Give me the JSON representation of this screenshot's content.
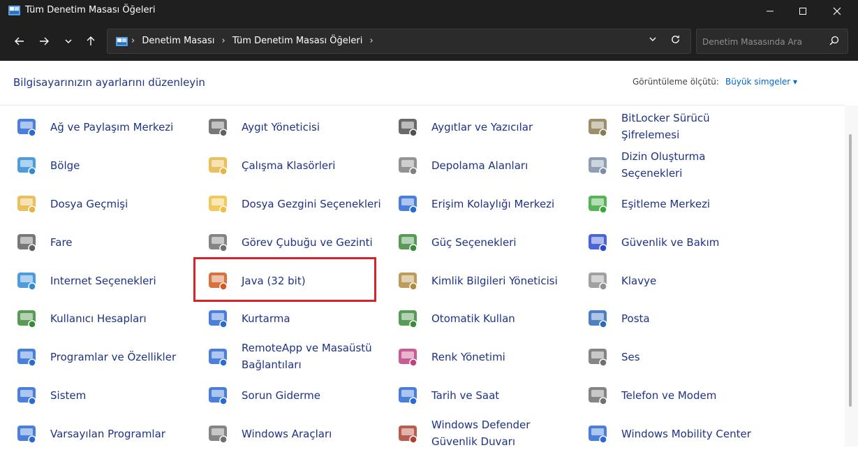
{
  "window": {
    "title": "Tüm Denetim Masası Öğeleri",
    "minimize_icon": "minimize-icon",
    "maximize_icon": "maximize-icon",
    "close_icon": "close-icon"
  },
  "address": {
    "breadcrumbs": [
      "Denetim Masası",
      "Tüm Denetim Masası Öğeleri"
    ],
    "separator": "›"
  },
  "search": {
    "placeholder": "Denetim Masasında Ara"
  },
  "page": {
    "heading": "Bilgisayarınızın ayarlarını düzenleyin",
    "view_by_label": "Görüntüleme ölçütü:",
    "view_by_value": "Büyük simgeler ▾"
  },
  "items": [
    {
      "l1": "Ağ ve Paylaşım Merkezi",
      "l2": "",
      "icon": "network-icon",
      "color": "#2a6ad6"
    },
    {
      "l1": "Aygıt Yöneticisi",
      "l2": "",
      "icon": "device-manager-icon",
      "color": "#606060"
    },
    {
      "l1": "Aygıtlar ve Yazıcılar",
      "l2": "",
      "icon": "printer-icon",
      "color": "#505050"
    },
    {
      "l1": "BitLocker Sürücü",
      "l2": "Şifrelemesi",
      "icon": "bitlocker-icon",
      "color": "#8a7a50"
    },
    {
      "l1": "Bölge",
      "l2": "",
      "icon": "globe-clock-icon",
      "color": "#2e8bd8"
    },
    {
      "l1": "Çalışma Klasörleri",
      "l2": "",
      "icon": "work-folders-icon",
      "color": "#e8b440"
    },
    {
      "l1": "Depolama Alanları",
      "l2": "",
      "icon": "storage-icon",
      "color": "#808080"
    },
    {
      "l1": "Dizin Oluşturma",
      "l2": "Seçenekleri",
      "icon": "indexing-icon",
      "color": "#7a8ea8"
    },
    {
      "l1": "Dosya Geçmişi",
      "l2": "",
      "icon": "file-history-icon",
      "color": "#e8b440"
    },
    {
      "l1": "Dosya Gezgini Seçenekleri",
      "l2": "",
      "icon": "folder-options-icon",
      "color": "#f0c040"
    },
    {
      "l1": "Erişim Kolaylığı Merkezi",
      "l2": "",
      "icon": "accessibility-icon",
      "color": "#2a6ad6"
    },
    {
      "l1": "Eşitleme Merkezi",
      "l2": "",
      "icon": "sync-icon",
      "color": "#3aa83a"
    },
    {
      "l1": "Fare",
      "l2": "",
      "icon": "mouse-icon",
      "color": "#606060"
    },
    {
      "l1": "Görev Çubuğu ve Gezinti",
      "l2": "",
      "icon": "taskbar-icon",
      "color": "#707070"
    },
    {
      "l1": "Güç Seçenekleri",
      "l2": "",
      "icon": "power-icon",
      "color": "#3a8a3a"
    },
    {
      "l1": "Güvenlik ve Bakım",
      "l2": "",
      "icon": "security-flag-icon",
      "color": "#2a4ad6"
    },
    {
      "l1": "Internet Seçenekleri",
      "l2": "",
      "icon": "internet-options-icon",
      "color": "#2e8bd8"
    },
    {
      "l1": "Java (32 bit)",
      "l2": "",
      "icon": "java-icon",
      "color": "#d05a20"
    },
    {
      "l1": "Kimlik Bilgileri Yöneticisi",
      "l2": "",
      "icon": "credential-icon",
      "color": "#b08a40"
    },
    {
      "l1": "Klavye",
      "l2": "",
      "icon": "keyboard-icon",
      "color": "#909090"
    },
    {
      "l1": "Kullanıcı Hesapları",
      "l2": "",
      "icon": "user-accounts-icon",
      "color": "#3a8a3a"
    },
    {
      "l1": "Kurtarma",
      "l2": "",
      "icon": "recovery-icon",
      "color": "#2a6ad6"
    },
    {
      "l1": "Otomatik Kullan",
      "l2": "",
      "icon": "autoplay-icon",
      "color": "#3a8a3a"
    },
    {
      "l1": "Posta",
      "l2": "",
      "icon": "mail-icon",
      "color": "#2e6ab8"
    },
    {
      "l1": "Programlar ve Özellikler",
      "l2": "",
      "icon": "programs-icon",
      "color": "#2a6ad6"
    },
    {
      "l1": "RemoteApp ve Masaüstü",
      "l2": "Bağlantıları",
      "icon": "remoteapp-icon",
      "color": "#2a6ad6"
    },
    {
      "l1": "Renk Yönetimi",
      "l2": "",
      "icon": "color-management-icon",
      "color": "#c04080"
    },
    {
      "l1": "Ses",
      "l2": "",
      "icon": "speaker-icon",
      "color": "#707070"
    },
    {
      "l1": "Sistem",
      "l2": "",
      "icon": "system-icon",
      "color": "#2a6ad6"
    },
    {
      "l1": "Sorun Giderme",
      "l2": "",
      "icon": "troubleshooting-icon",
      "color": "#2a6ad6"
    },
    {
      "l1": "Tarih ve Saat",
      "l2": "",
      "icon": "date-time-icon",
      "color": "#2a6ad6"
    },
    {
      "l1": "Telefon ve Modem",
      "l2": "",
      "icon": "phone-modem-icon",
      "color": "#707070"
    },
    {
      "l1": "Varsayılan Programlar",
      "l2": "",
      "icon": "default-programs-icon",
      "color": "#2a6ad6"
    },
    {
      "l1": "Windows Araçları",
      "l2": "",
      "icon": "windows-tools-icon",
      "color": "#707070"
    },
    {
      "l1": "Windows Defender",
      "l2": "Güvenlik Duvarı",
      "icon": "firewall-icon",
      "color": "#b04030"
    },
    {
      "l1": "Windows Mobility Center",
      "l2": "",
      "icon": "mobility-center-icon",
      "color": "#2a6ad6"
    }
  ],
  "colors": {
    "titlebar": "#1f1f1f",
    "link": "#1e3287",
    "highlight": "#d9232a"
  }
}
